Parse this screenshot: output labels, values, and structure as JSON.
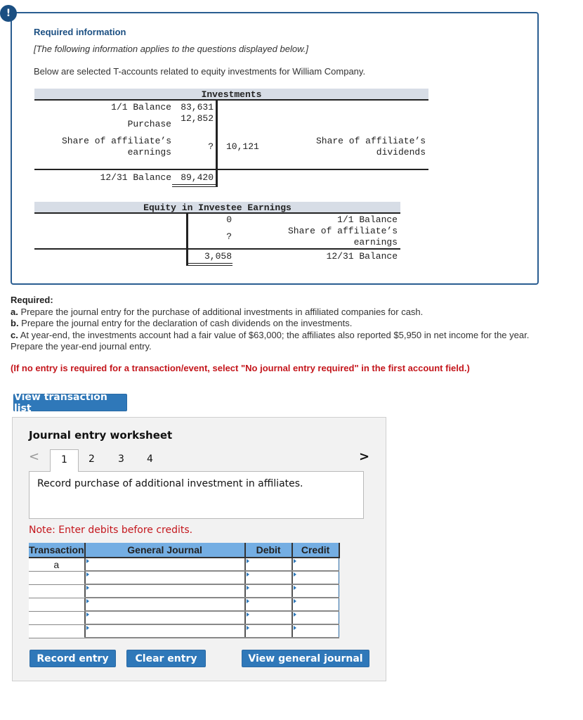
{
  "info": {
    "alert_icon": "!",
    "title": "Required information",
    "italic_note": "[The following information applies to the questions displayed below.]",
    "description": "Below are selected T-accounts related to equity investments for William Company."
  },
  "investments": {
    "title": "Investments",
    "debit_labels": {
      "opening": "1/1 Balance",
      "purchase": "Purchase",
      "share_earnings_1": "Share of affiliate’s",
      "share_earnings_2": "earnings",
      "closing": "12/31 Balance"
    },
    "debit_values": {
      "opening": "83,631",
      "purchase": "12,852",
      "share_earnings": "?",
      "closing": "89,420"
    },
    "credit_values": {
      "dividends": "10,121"
    },
    "credit_labels": {
      "dividends_1": "Share of affiliate’s",
      "dividends_2": "dividends"
    }
  },
  "equity_earnings": {
    "title": "Equity in Investee Earnings",
    "credit_values": {
      "opening": "0",
      "share_earnings": "?",
      "closing": "3,058"
    },
    "credit_labels": {
      "opening": "1/1 Balance",
      "share_earnings_1": "Share of affiliate’s",
      "share_earnings_2": "earnings",
      "closing": "12/31 Balance"
    }
  },
  "required": {
    "heading": "Required:",
    "items": [
      {
        "letter": "a.",
        "text": " Prepare the journal entry for the purchase of additional investments in affiliated companies for cash."
      },
      {
        "letter": "b.",
        "text": " Prepare the journal entry for the declaration of cash dividends on the investments."
      },
      {
        "letter": "c.",
        "text": " At year-end, the investments account had a fair value of $63,000; the affiliates also reported $5,950 in net income for the year. Prepare the year-end journal entry."
      }
    ],
    "note": "(If no entry is required for a transaction/event, select \"No journal entry required\" in the first account field.)"
  },
  "buttons": {
    "view_transaction_list": "View transaction list",
    "record_entry": "Record entry",
    "clear_entry": "Clear entry",
    "view_general_journal": "View general journal"
  },
  "worksheet": {
    "title": "Journal entry worksheet",
    "prev_icon": "<",
    "next_icon": ">",
    "tabs": [
      "1",
      "2",
      "3",
      "4"
    ],
    "active_tab": "1",
    "description": "Record purchase of additional investment in affiliates.",
    "note": "Note: Enter debits before credits.",
    "columns": [
      "Transaction",
      "General Journal",
      "Debit",
      "Credit"
    ],
    "rows": [
      {
        "transaction": "a",
        "account": "",
        "debit": "",
        "credit": ""
      },
      {
        "transaction": "",
        "account": "",
        "debit": "",
        "credit": ""
      },
      {
        "transaction": "",
        "account": "",
        "debit": "",
        "credit": ""
      },
      {
        "transaction": "",
        "account": "",
        "debit": "",
        "credit": ""
      },
      {
        "transaction": "",
        "account": "",
        "debit": "",
        "credit": ""
      },
      {
        "transaction": "",
        "account": "",
        "debit": "",
        "credit": ""
      }
    ]
  }
}
